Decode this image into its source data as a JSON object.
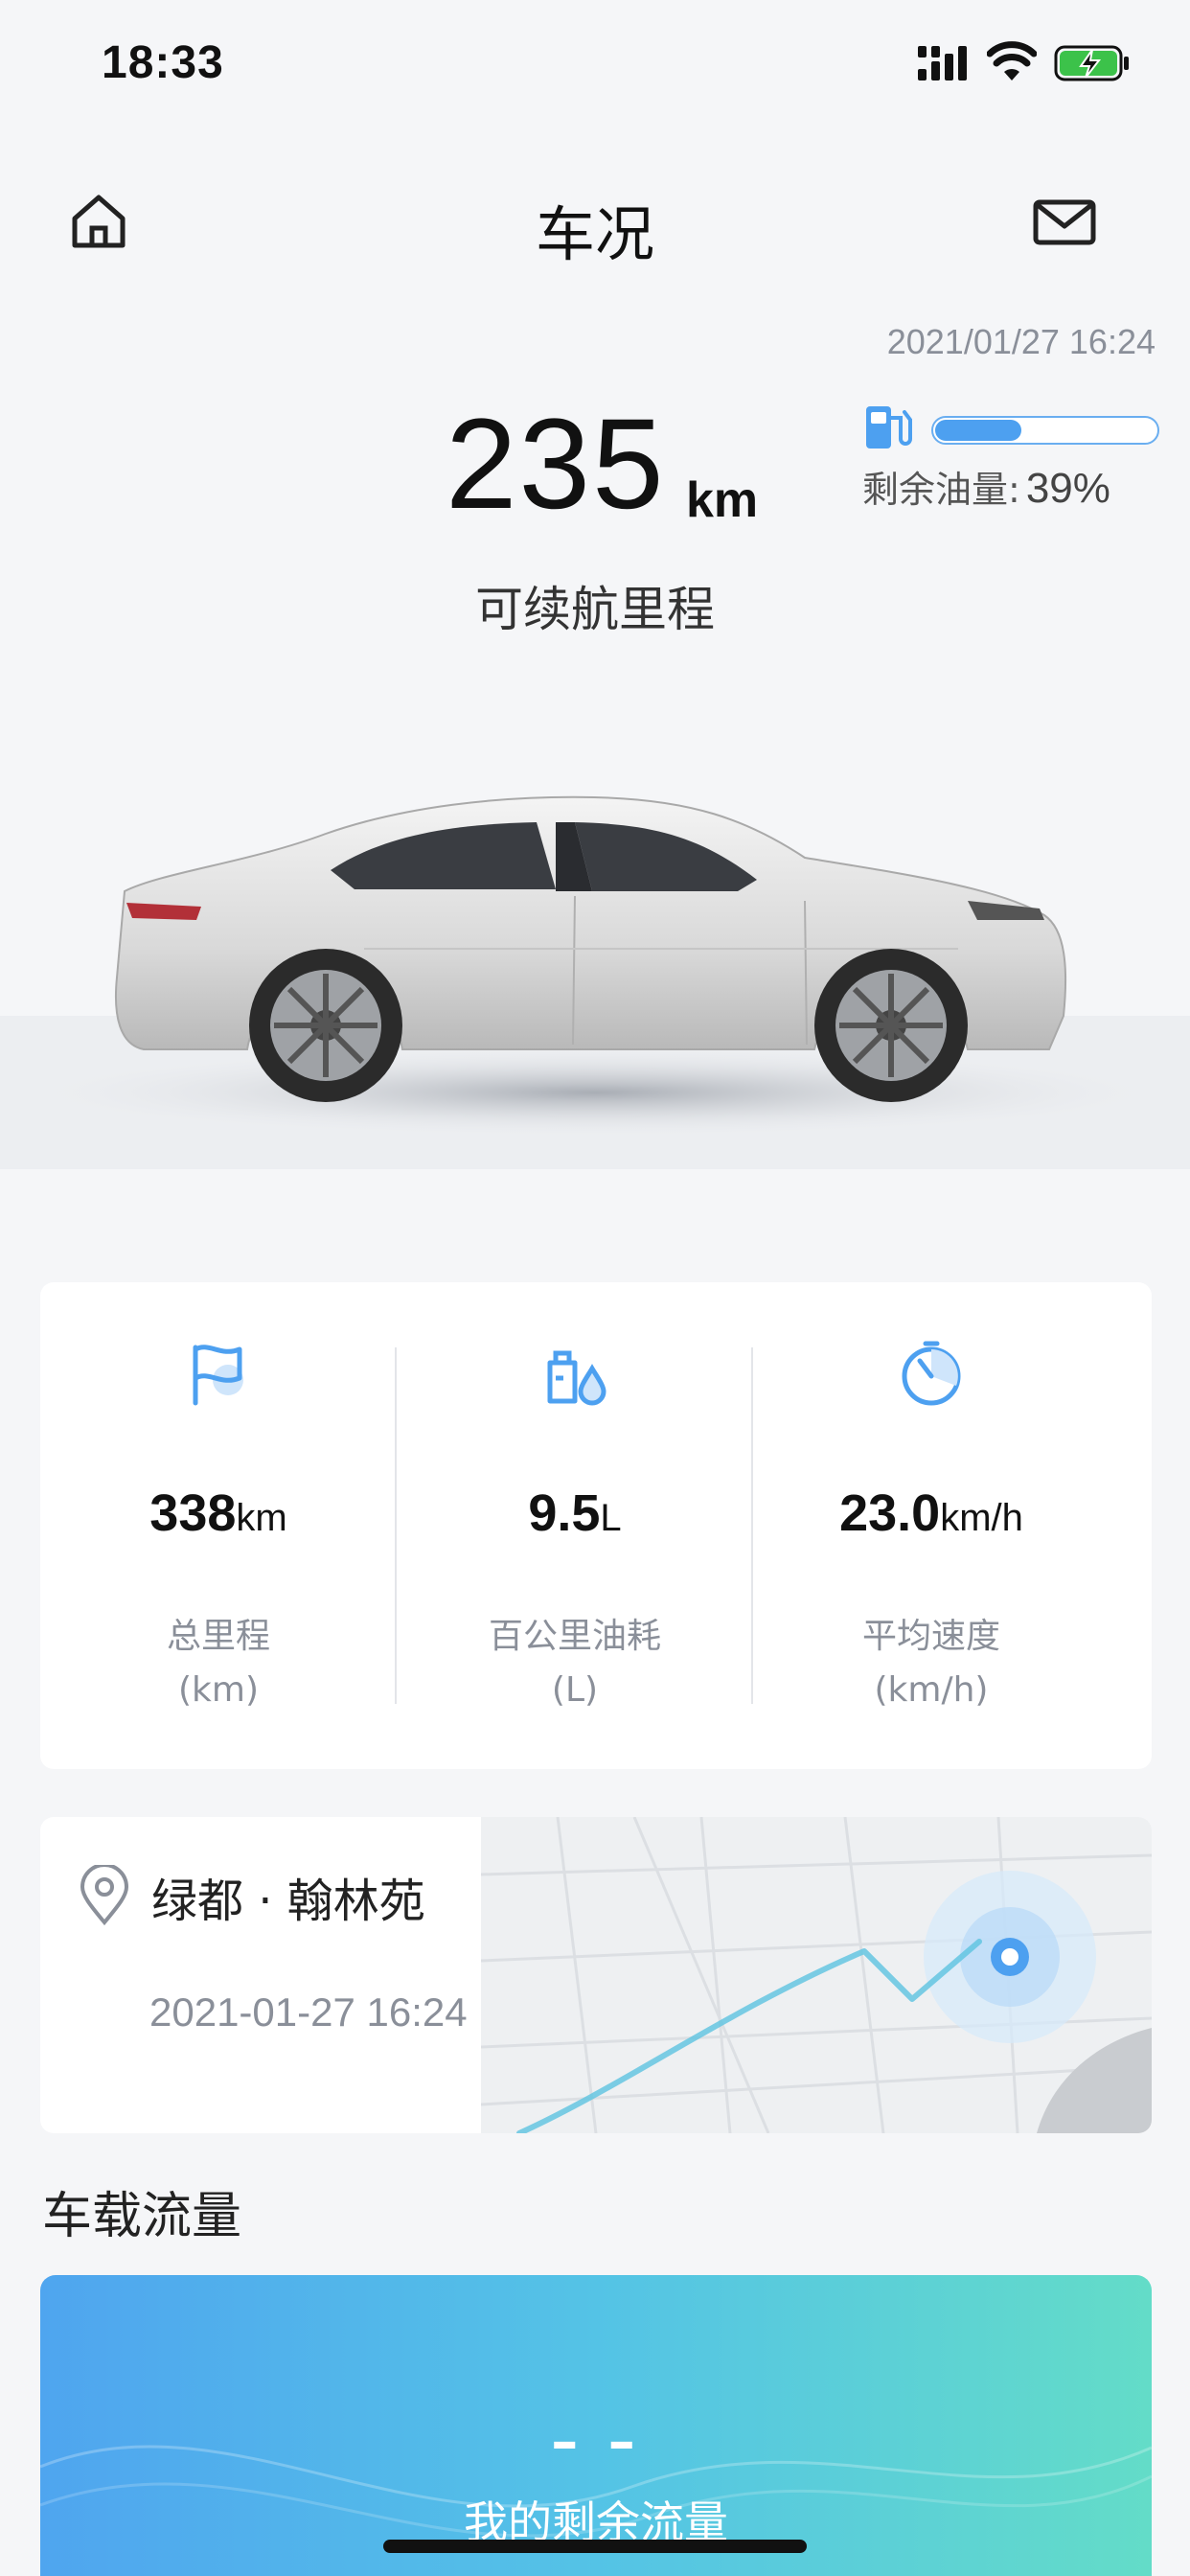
{
  "status_bar": {
    "time": "18:33"
  },
  "nav": {
    "title": "车况"
  },
  "range": {
    "timestamp": "2021/01/27 16:24",
    "value": "235",
    "unit": "km",
    "label": "可续航里程"
  },
  "fuel": {
    "label": "剩余油量:",
    "percent_text": "39%",
    "level": 0.39
  },
  "stats": [
    {
      "icon": "flag-icon",
      "value": "338",
      "unit": "km",
      "label": "总里程",
      "sub": "(km)"
    },
    {
      "icon": "oil-drop-icon",
      "value": "9.5",
      "unit": "L",
      "label": "百公里油耗",
      "sub": "(L)"
    },
    {
      "icon": "speed-dial-icon",
      "value": "23.0",
      "unit": "km/h",
      "label": "平均速度",
      "sub": "(km/h)"
    }
  ],
  "location": {
    "name": "绿都 · 翰林苑",
    "datetime": "2021-01-27 16:24"
  },
  "data_section": {
    "title": "车载流量",
    "value": "– –",
    "label": "我的剩余流量"
  },
  "colors": {
    "accent": "#4da0f0",
    "background": "#f5f6f8"
  }
}
